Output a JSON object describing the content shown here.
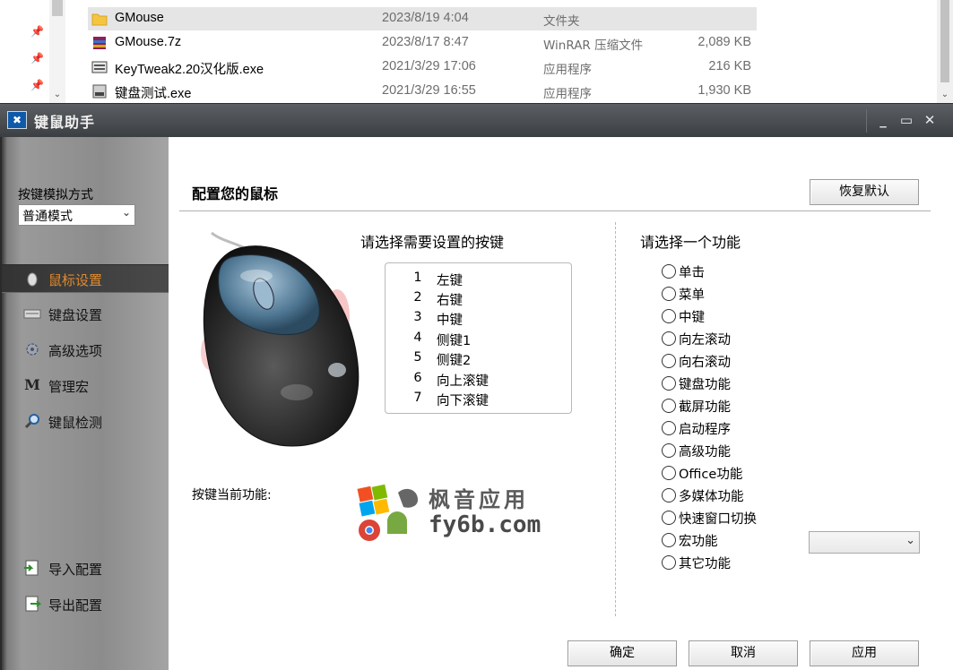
{
  "explorer": {
    "files": [
      {
        "name": "GMouse",
        "date": "2023/8/19 4:04",
        "type": "文件夹",
        "size": "",
        "icon": "folder-icon",
        "selected": true
      },
      {
        "name": "GMouse.7z",
        "date": "2023/8/17 8:47",
        "type": "WinRAR 压缩文件",
        "size": "2,089 KB",
        "icon": "archive-icon",
        "selected": false
      },
      {
        "name": "KeyTweak2.20汉化版.exe",
        "date": "2021/3/29 17:06",
        "type": "应用程序",
        "size": "216 KB",
        "icon": "keyboard-app-icon",
        "selected": false
      },
      {
        "name": "键盘测试.exe",
        "date": "2021/3/29 16:55",
        "type": "应用程序",
        "size": "1,930 KB",
        "icon": "app-icon",
        "selected": false
      }
    ]
  },
  "window": {
    "title": "键鼠助手",
    "controls": {
      "minimize": "_",
      "maximize": "▭",
      "close": "✕"
    }
  },
  "sidebar": {
    "mode_label": "按键模拟方式",
    "mode_value": "普通模式",
    "items": [
      {
        "label": "鼠标设置",
        "icon": "mouse-icon",
        "active": true
      },
      {
        "label": "键盘设置",
        "icon": "keyboard-icon",
        "active": false
      },
      {
        "label": "高级选项",
        "icon": "gear-icon",
        "active": false
      },
      {
        "label": "管理宏",
        "icon": "macro-icon",
        "active": false
      },
      {
        "label": "键鼠检测",
        "icon": "magnifier-icon",
        "active": false
      }
    ],
    "import_label": "导入配置",
    "export_label": "导出配置"
  },
  "main": {
    "heading": "配置您的鼠标",
    "reset_label": "恢复默认",
    "select_key_title": "请选择需要设置的按键",
    "keys": [
      {
        "num": "1",
        "label": "左键"
      },
      {
        "num": "2",
        "label": "右键"
      },
      {
        "num": "3",
        "label": "中键"
      },
      {
        "num": "4",
        "label": "侧键1"
      },
      {
        "num": "5",
        "label": "侧键2"
      },
      {
        "num": "6",
        "label": "向上滚键"
      },
      {
        "num": "7",
        "label": "向下滚键"
      }
    ],
    "current_function_label": "按键当前功能:",
    "select_function_title": "请选择一个功能",
    "functions": [
      "单击",
      "菜单",
      "中键",
      "向左滚动",
      "向右滚动",
      "键盘功能",
      "截屏功能",
      "启动程序",
      "高级功能",
      "Office功能",
      "多媒体功能",
      "快速窗口切换",
      "宏功能",
      "其它功能"
    ],
    "ok_label": "确定",
    "cancel_label": "取消",
    "apply_label": "应用"
  },
  "watermark": {
    "line1": "枫音应用",
    "line2": "fy6b.com"
  }
}
